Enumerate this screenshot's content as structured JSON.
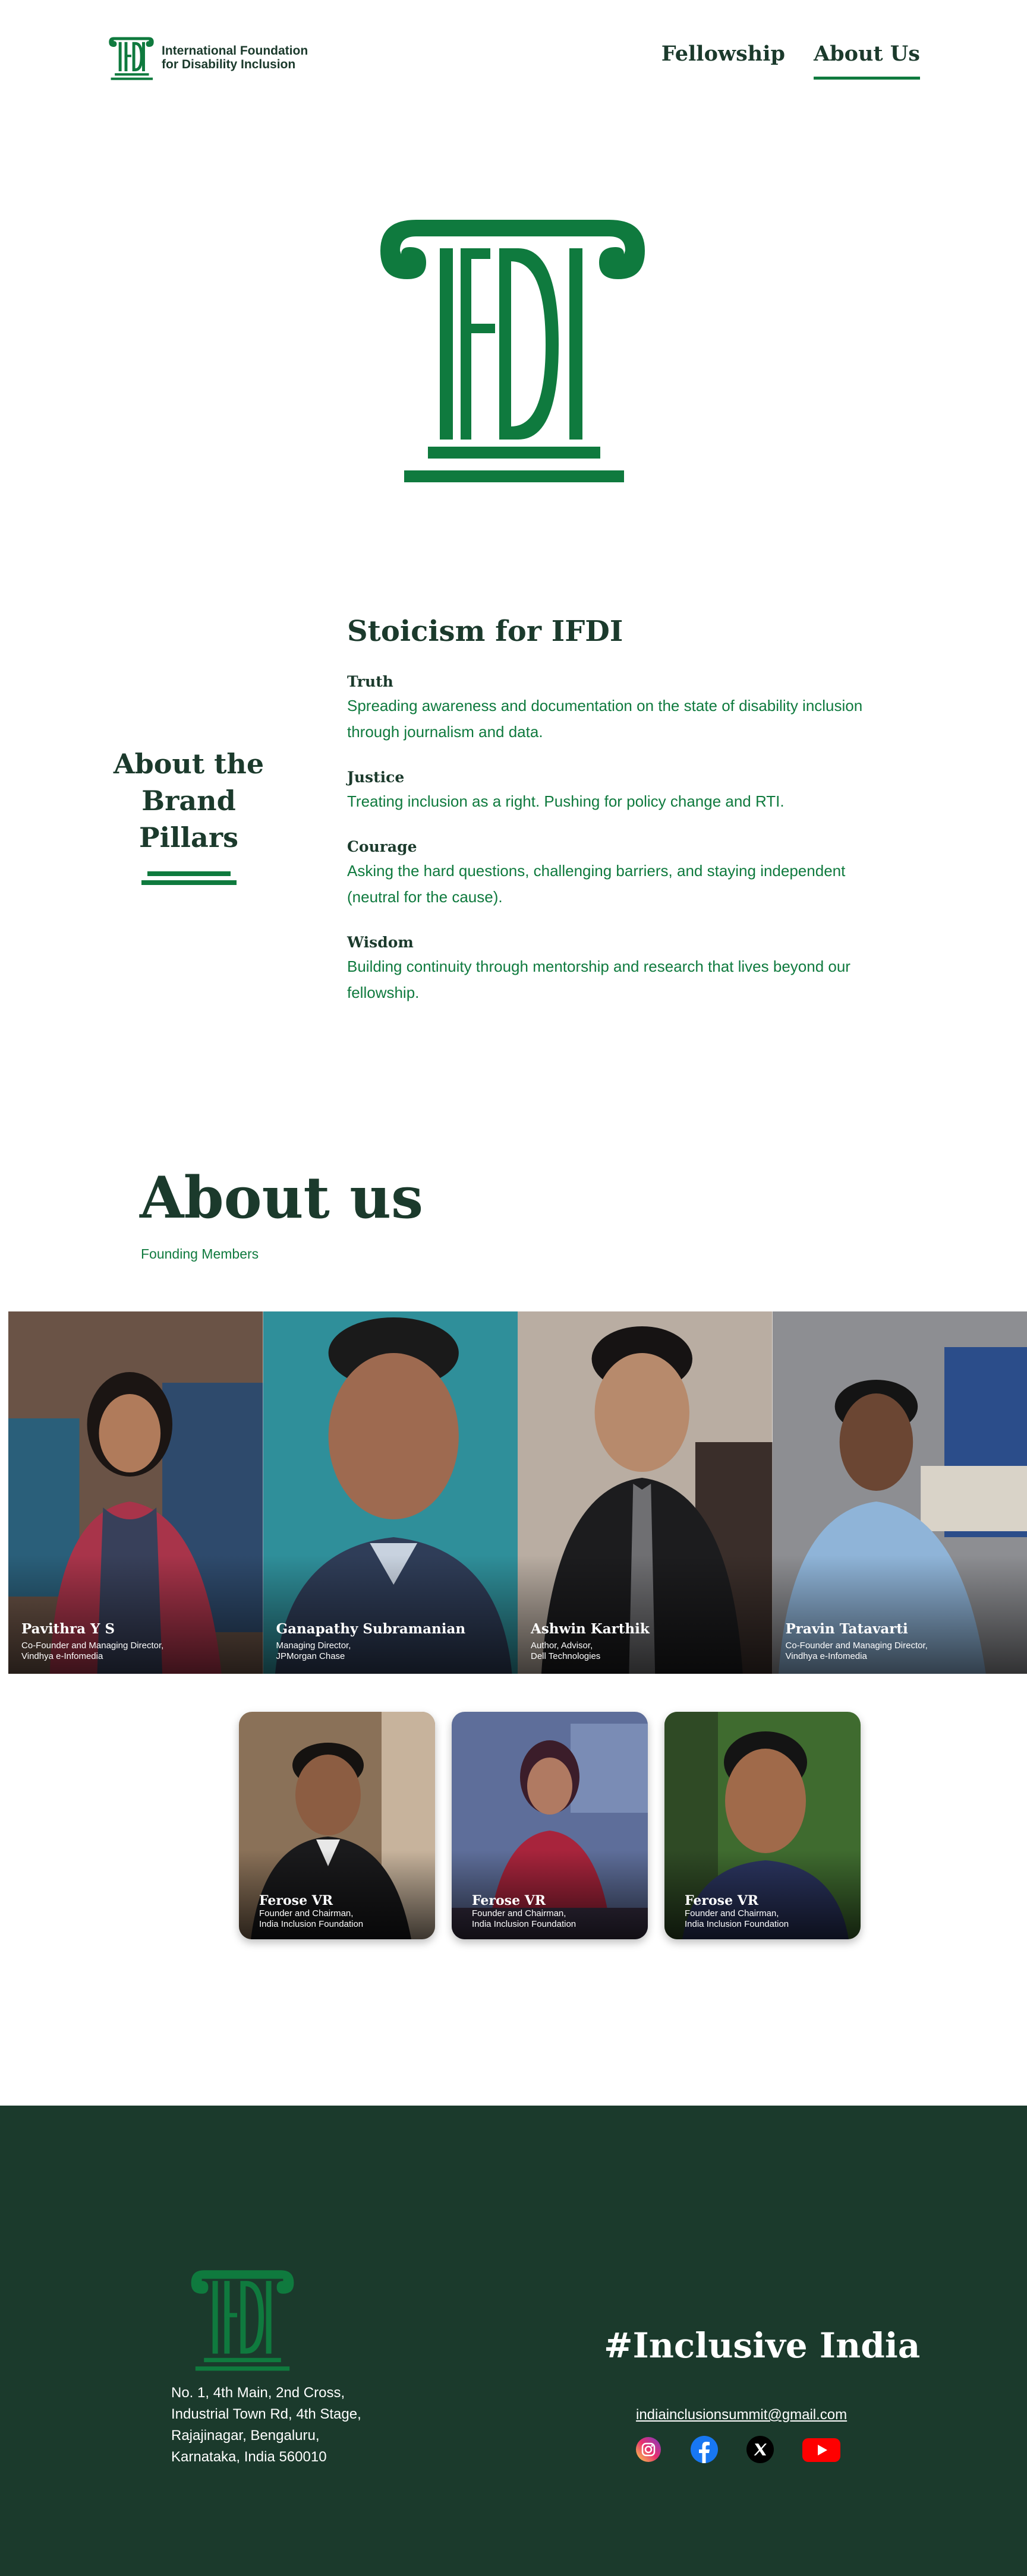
{
  "header": {
    "logo_line1": "International Foundation",
    "logo_line2": "for Disability Inclusion",
    "nav": [
      {
        "label": "Fellowship"
      },
      {
        "label": "About Us",
        "active": true
      }
    ]
  },
  "pillars": {
    "left_title_line1": "About the",
    "left_title_line2": "Brand Pillars",
    "heading": "Stoicism for IFDI",
    "items": [
      {
        "title": "Truth",
        "text": "Spreading awareness and documentation on the state of disability inclusion through journalism and data."
      },
      {
        "title": "Justice",
        "text": "Treating inclusion as a right. Pushing for policy change and RTI."
      },
      {
        "title": "Courage",
        "text": "Asking the hard questions, challenging barriers, and staying independent (neutral for the cause)."
      },
      {
        "title": "Wisdom",
        "text": "Building continuity through mentorship and research that lives beyond our fellowship."
      }
    ]
  },
  "about": {
    "title": "About us",
    "subtitle": "Founding Members",
    "members": [
      {
        "name": "Pavithra Y S",
        "role1": "Co-Founder and Managing Director,",
        "role2": "Vindhya e-Infomedia"
      },
      {
        "name": "Ganapathy Subramanian",
        "role1": "Managing Director,",
        "role2": "JPMorgan Chase"
      },
      {
        "name": "Ashwin Karthik",
        "role1": "Author, Advisor,",
        "role2": "Dell Technologies"
      },
      {
        "name": "Pravin Tatavarti",
        "role1": "Co-Founder and Managing Director,",
        "role2": "Vindhya e-Infomedia"
      }
    ],
    "cards": [
      {
        "name": "Ferose VR",
        "role1": "Founder and Chairman,",
        "role2": "India Inclusion Foundation"
      },
      {
        "name": "Ferose VR",
        "role1": "Founder and Chairman,",
        "role2": "India Inclusion Foundation"
      },
      {
        "name": "Ferose VR",
        "role1": "Founder and Chairman,",
        "role2": "India Inclusion Foundation"
      }
    ]
  },
  "footer": {
    "address_lines": [
      "No. 1, 4th Main, 2nd Cross,",
      "Industrial Town Rd, 4th Stage,",
      "Rajajinagar, Bengaluru,",
      "Karnataka, India 560010"
    ],
    "hashtag": "#Inclusive India",
    "email": "indiainclusionsummit@gmail.com",
    "socials": [
      "instagram-icon",
      "facebook-icon",
      "x-icon",
      "youtube-icon"
    ]
  },
  "colors": {
    "brand_green": "#0f7a3e",
    "dark_green": "#1b3a2c",
    "white": "#ffffff"
  }
}
